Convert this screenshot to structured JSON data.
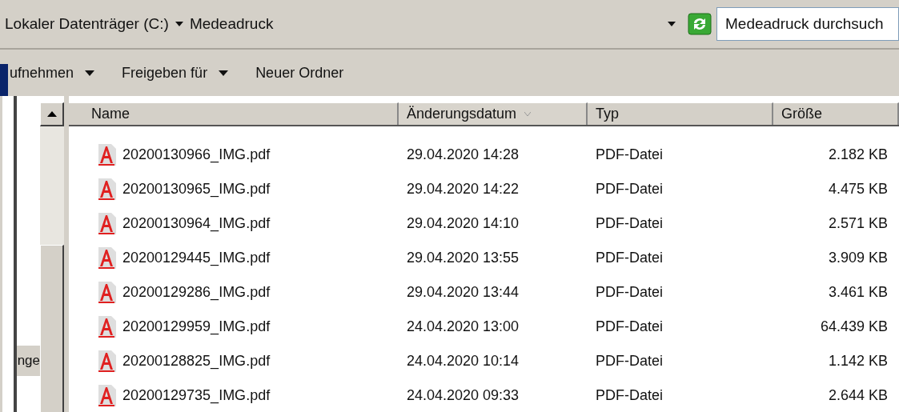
{
  "address_bar": {
    "breadcrumb": [
      "Lokaler Datenträger (C:)",
      "Medeadruck"
    ]
  },
  "search": {
    "placeholder": "Medeadruck durchsuch"
  },
  "toolbar": [
    {
      "label": "ufnehmen",
      "dropdown": true
    },
    {
      "label": "Freigeben für",
      "dropdown": true
    },
    {
      "label": "Neuer Ordner",
      "dropdown": false
    }
  ],
  "navigation_pane": {
    "items": [
      {
        "label": "nge",
        "selected": true
      }
    ]
  },
  "table": {
    "columns": [
      {
        "label": "Name",
        "sorted": false
      },
      {
        "label": "Änderungsdatum",
        "sorted": true
      },
      {
        "label": "Typ",
        "sorted": false
      },
      {
        "label": "Größe",
        "sorted": false
      }
    ],
    "rows": [
      {
        "name": "20200130966_IMG.pdf",
        "date": "29.04.2020 14:28",
        "type": "PDF-Datei",
        "size": "2.182 KB"
      },
      {
        "name": "20200130965_IMG.pdf",
        "date": "29.04.2020 14:22",
        "type": "PDF-Datei",
        "size": "4.475 KB"
      },
      {
        "name": "20200130964_IMG.pdf",
        "date": "29.04.2020 14:10",
        "type": "PDF-Datei",
        "size": "2.571 KB"
      },
      {
        "name": "20200129445_IMG.pdf",
        "date": "29.04.2020 13:55",
        "type": "PDF-Datei",
        "size": "3.909 KB"
      },
      {
        "name": "20200129286_IMG.pdf",
        "date": "29.04.2020 13:44",
        "type": "PDF-Datei",
        "size": "3.461 KB"
      },
      {
        "name": "20200129959_IMG.pdf",
        "date": "24.04.2020 13:00",
        "type": "PDF-Datei",
        "size": "64.439 KB"
      },
      {
        "name": "20200128825_IMG.pdf",
        "date": "24.04.2020 10:14",
        "type": "PDF-Datei",
        "size": "1.142 KB"
      },
      {
        "name": "20200129735_IMG.pdf",
        "date": "24.04.2020 09:33",
        "type": "PDF-Datei",
        "size": "2.644 KB"
      }
    ]
  }
}
